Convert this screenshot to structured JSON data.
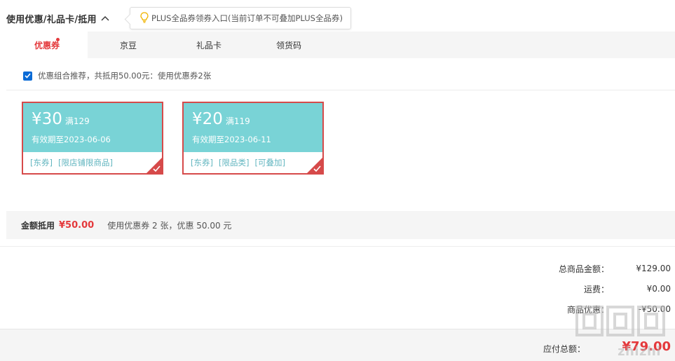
{
  "header": {
    "title": "使用优惠/礼品卡/抵用",
    "tip": "PLUS全品券领券入口(当前订单不可叠加PLUS全品券)"
  },
  "tabs": [
    {
      "label": "优惠券",
      "active": true
    },
    {
      "label": "京豆",
      "active": false
    },
    {
      "label": "礼品卡",
      "active": false
    },
    {
      "label": "领货码",
      "active": false
    }
  ],
  "combo": {
    "checked": true,
    "text": "优惠组合推荐，共抵用50.00元：使用优惠券2张"
  },
  "coupons": [
    {
      "amount": "¥30",
      "condition": "满129",
      "validity": "有效期至2023-06-06",
      "tags": [
        "[东券]",
        "[限店铺限商品]"
      ],
      "selected": true
    },
    {
      "amount": "¥20",
      "condition": "满119",
      "validity": "有效期至2023-06-11",
      "tags": [
        "[东券]",
        "[限品类]",
        "[可叠加]"
      ],
      "selected": true
    }
  ],
  "summary": {
    "label": "金额抵用",
    "amount": "¥50.00",
    "desc": "使用优惠券 2 张，优惠 50.00 元"
  },
  "totals": [
    {
      "label": "总商品金额：",
      "value": "¥129.00"
    },
    {
      "label": "运费：",
      "value": "¥0.00"
    },
    {
      "label": "商品优惠：",
      "value": "-¥50.00"
    }
  ],
  "payable": {
    "label": "应付总额：",
    "value": "¥79.00"
  },
  "watermark": {
    "text": "zhizhi"
  },
  "colors": {
    "accent": "#e4393c",
    "coupon_bg": "#79d3d6",
    "coupon_border": "#d64a4a",
    "tag_text": "#63b6c0",
    "checkbox": "#0a6bd6"
  }
}
